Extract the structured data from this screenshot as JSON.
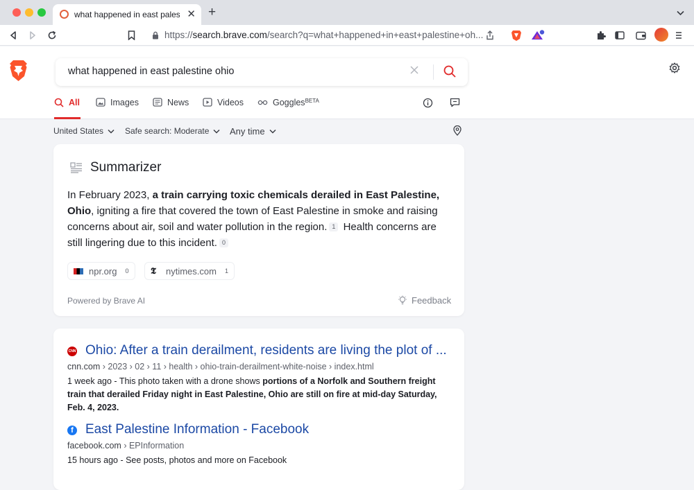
{
  "browser": {
    "tab_title": "what happened in east palestine ohio",
    "url_prefix": "https://",
    "url_domain": "search.brave.com",
    "url_path": "/search?q=what+happened+in+east+palestine+oh...",
    "new_tab_label": "+",
    "close_tab_label": "✕"
  },
  "search": {
    "query": "what happened in east palestine ohio",
    "tabs": [
      {
        "label": "All",
        "active": true
      },
      {
        "label": "Images",
        "active": false
      },
      {
        "label": "News",
        "active": false
      },
      {
        "label": "Videos",
        "active": false
      },
      {
        "label": "Goggles",
        "active": false,
        "badge": "BETA"
      }
    ],
    "filters": {
      "region": "United States",
      "safe_search": "Safe search: Moderate",
      "time": "Any time"
    }
  },
  "summarizer": {
    "title": "Summarizer",
    "intro": "In February 2023, ",
    "bold": "a train carrying toxic chemicals derailed in East Palestine, Ohio",
    "rest": ", igniting a fire that covered the town of East Palestine in smoke and raising concerns about air, soil and water pollution in the region.",
    "cite1": "1",
    "second": "Health concerns are still lingering due to this incident.",
    "cite2": "0",
    "sources": [
      {
        "domain": "npr.org",
        "count": "0"
      },
      {
        "domain": "nytimes.com",
        "count": "1"
      }
    ],
    "powered_by": "Powered by Brave AI",
    "feedback": "Feedback"
  },
  "results": [
    {
      "title": "Ohio: After a train derailment, residents are living the plot of ...",
      "domain": "cnn.com",
      "path": "› 2023 › 02 › 11 › health › ohio-train-derailment-white-noise › index.html",
      "age": "1 week ago - ",
      "desc_plain": "This photo taken with a drone shows ",
      "desc_bold": "portions of a Norfolk and Southern freight train that derailed Friday night in East Palestine, Ohio are still on fire at mid-day Saturday, Feb. 4, 2023.",
      "favicon_text": "CNN"
    },
    {
      "title": "East Palestine Information - Facebook",
      "domain": "facebook.com",
      "path": "› EPInformation",
      "desc": "15 hours ago - See posts, photos and more on Facebook",
      "favicon_text": "f"
    }
  ],
  "colors": {
    "accent": "#e12b2b",
    "link": "#1c49a5",
    "brand": "#fb542b"
  }
}
